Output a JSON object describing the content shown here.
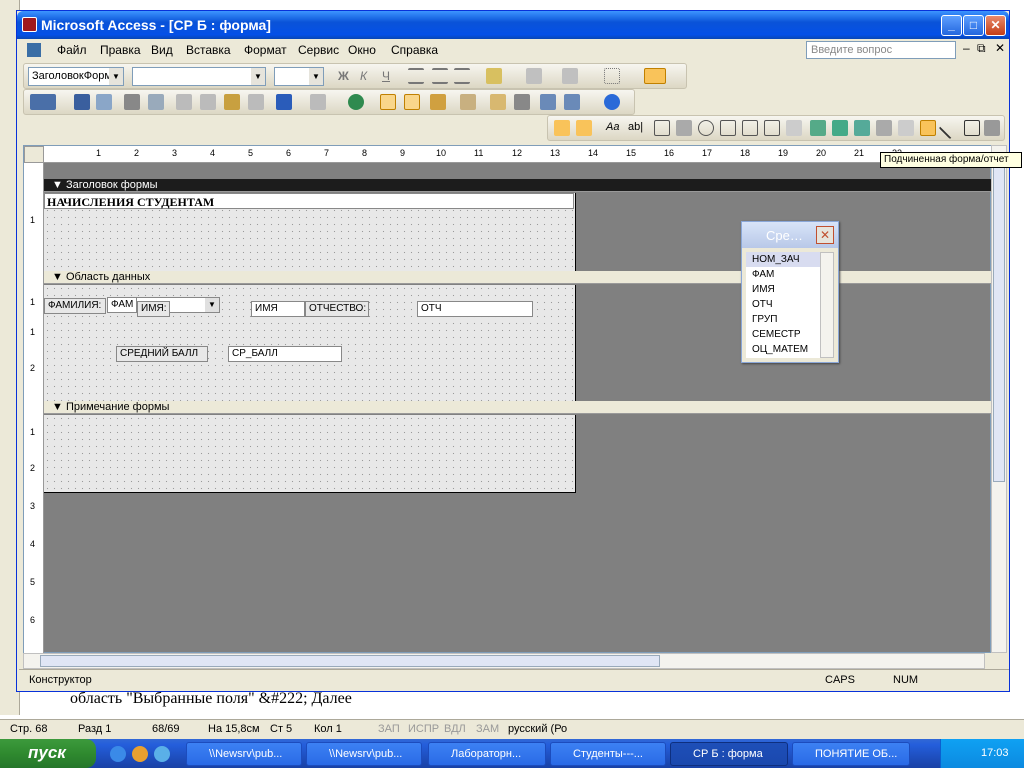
{
  "window": {
    "title": "Microsoft Access - [СР Б : форма]"
  },
  "menu": [
    "Файл",
    "Правка",
    "Вид",
    "Вставка",
    "Формат",
    "Сервис",
    "Окно",
    "Справка"
  ],
  "ask_placeholder": "Введите вопрос",
  "format_toolbar": {
    "object_combo": "ЗаголовокФорм",
    "bold": "Ж",
    "italic": "К",
    "underline": "Ч"
  },
  "ruler_top": [
    "1",
    "2",
    "3",
    "4",
    "5",
    "6",
    "7",
    "8",
    "9",
    "10",
    "11",
    "12",
    "13",
    "14",
    "15",
    "16",
    "17",
    "18",
    "19",
    "20",
    "21",
    "22"
  ],
  "ruler_left": [
    "1",
    "1",
    "1",
    "2",
    "1",
    "2",
    "3",
    "4",
    "5",
    "6"
  ],
  "sections": {
    "header": "Заголовок формы",
    "detail": "Область данных",
    "footer": "Примечание формы"
  },
  "form_title": "НАЧИСЛЕНИЯ СТУДЕНТАМ",
  "controls": {
    "fam_label": "ФАМИЛИЯ:",
    "fam_box": "ФАМ",
    "name_label": "ИМЯ:",
    "name_box": "ИМЯ",
    "patr_label": "ОТЧЕСТВО:",
    "patr_box": "ОТЧ",
    "avg_label": "СРЕДНИЙ БАЛЛ",
    "avg_box": "СР_БАЛЛ"
  },
  "field_list": {
    "title": "Сре…",
    "items": [
      "НОМ_ЗАЧ",
      "ФАМ",
      "ИМЯ",
      "ОТЧ",
      "ГРУП",
      "СЕМЕСТР",
      "ОЦ_МАТЕМ"
    ]
  },
  "tooltip": "Подчиненная форма/отчет",
  "access_status": {
    "mode": "Конструктор",
    "caps": "CAPS",
    "num": "NUM"
  },
  "word_text": "область \"Выбранные поля\" &#222; Далее",
  "word_status": {
    "page": "Стр. 68",
    "section": "Разд 1",
    "pages": "68/69",
    "at": "На 15,8см",
    "line": "Ст 5",
    "col": "Кол 1",
    "rec": "ЗАП",
    "trk": "ИСПР",
    "ext": "ВДЛ",
    "ovr": "ЗАМ",
    "lang": "русский (Ро"
  },
  "taskbar": {
    "start": "пуск",
    "tasks": [
      "\\\\Newsrv\\pub...",
      "\\\\Newsrv\\pub...",
      "Лабораторн...",
      "Студенты---...",
      "СР Б : форма",
      "ПОНЯТИЕ ОБ..."
    ],
    "clock": "17:03"
  }
}
